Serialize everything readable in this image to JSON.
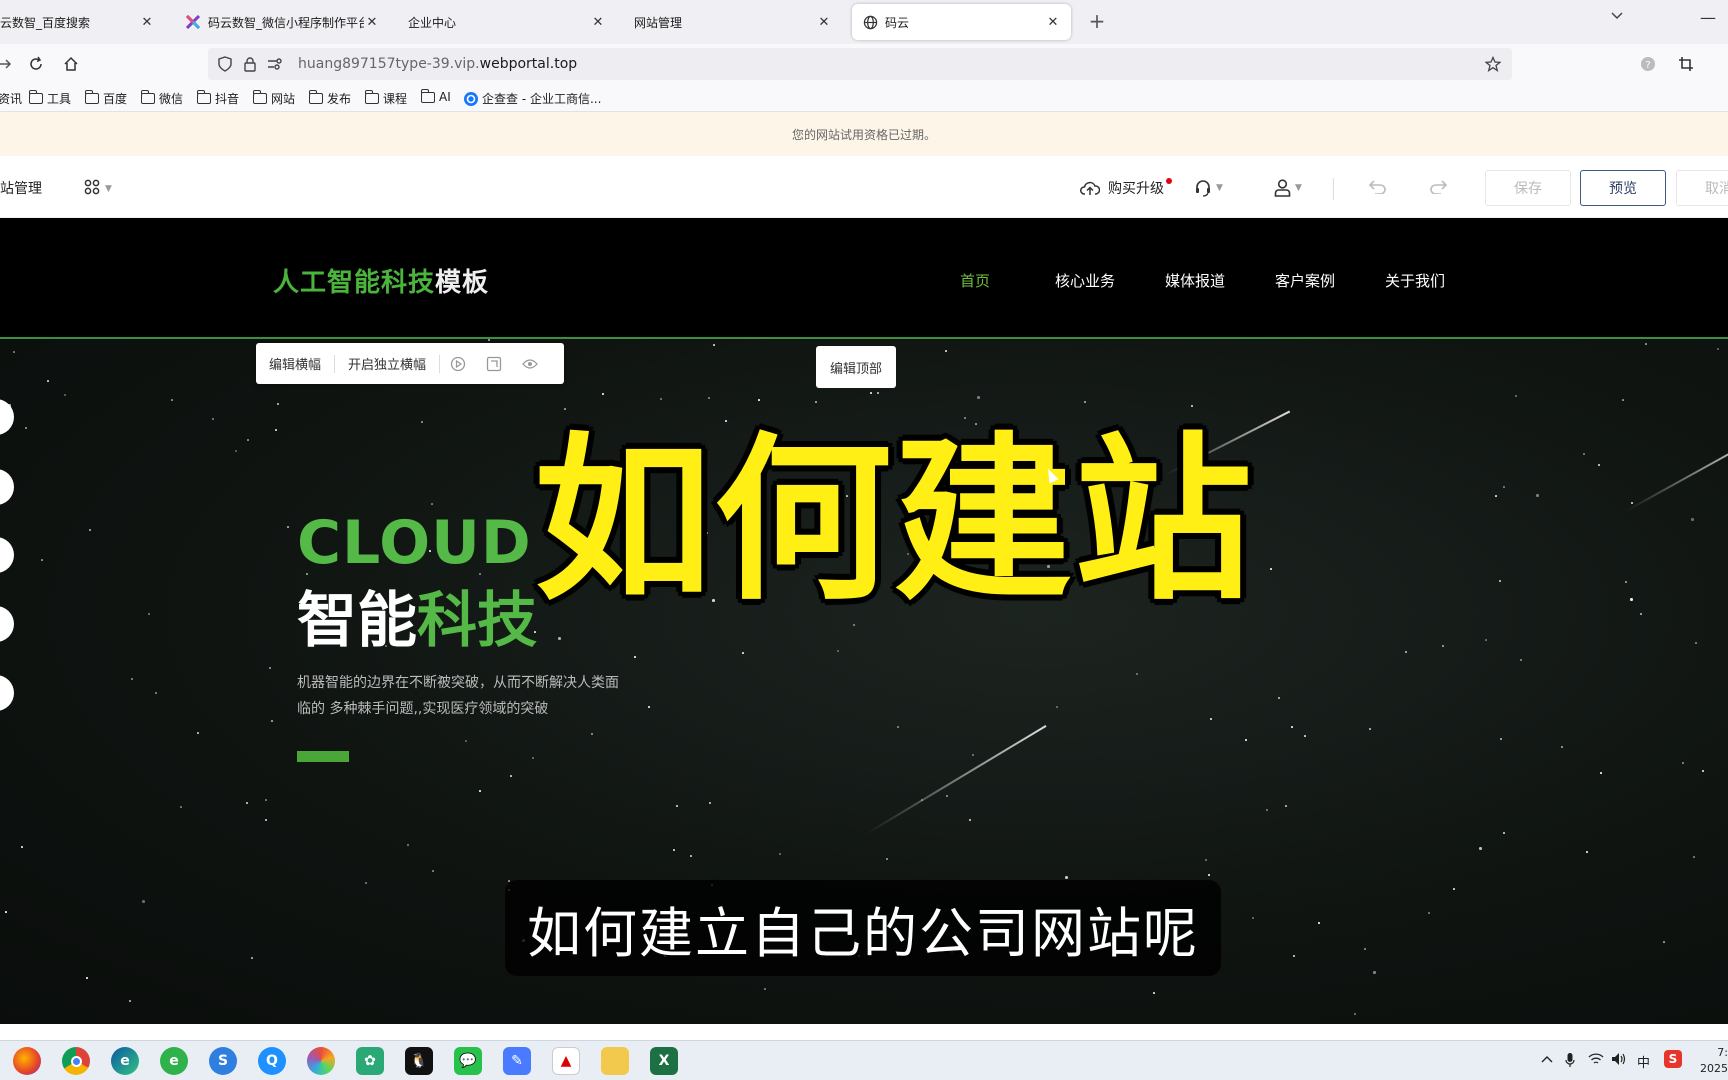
{
  "browser": {
    "tabs": [
      {
        "title": "云数智_百度搜索",
        "active": false
      },
      {
        "title": "码云数智_微信小程序制作平台_",
        "active": false
      },
      {
        "title": "企业中心",
        "active": false
      },
      {
        "title": "网站管理",
        "active": false
      },
      {
        "title": "码云",
        "active": true
      }
    ],
    "url_prefix": "huang897157type-39.vip.",
    "url_domain": "webportal.top",
    "bookmarks": [
      "资讯",
      "工具",
      "百度",
      "微信",
      "抖音",
      "网站",
      "发布",
      "课程",
      "AI",
      "企查查 - 企业工商信..."
    ]
  },
  "notice": "您的网站试用资格已过期。",
  "editor": {
    "title": "网站管理",
    "buy_upgrade": "购买升级",
    "save": "保存",
    "preview": "预览",
    "cancel": "取消"
  },
  "site": {
    "logo_green": "人工智能科技",
    "logo_white": "模板",
    "nav": [
      "首页",
      "核心业务",
      "媒体报道",
      "客户案例",
      "关于我们"
    ],
    "active_nav": "首页"
  },
  "banner_tools": {
    "edit_banner": "编辑横幅",
    "independent_banner": "开启独立横幅",
    "edit_top": "编辑顶部"
  },
  "hero": {
    "cloud": "CLOUD",
    "title_white": "智能",
    "title_green": "科技",
    "description_line1": "机器智能的边界在不断被突破，从而不断解决人类面",
    "description_line2": "临的  多种棘手问题,,实现医疗领域的突破"
  },
  "overlay": {
    "title": "如何建站",
    "subtitle": "如何建立自己的公司网站呢"
  },
  "taskbar": {
    "ime": "中",
    "clock_time": "7:",
    "clock_year": "2025"
  },
  "colors": {
    "accent_green": "#55b947",
    "overlay_yellow": "#ffef14",
    "notice_bg": "#fdf6e8",
    "preview_border": "#3d5a80"
  }
}
